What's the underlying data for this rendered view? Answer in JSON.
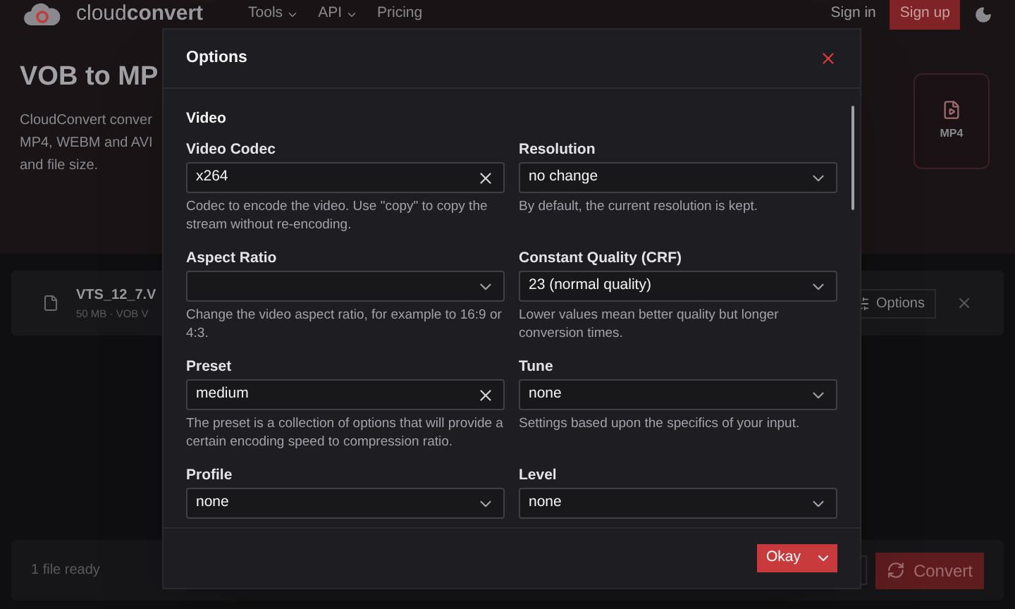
{
  "header": {
    "logo_text": "cloud**convert**",
    "nav": [
      {
        "label": "Tools",
        "dropdown": true
      },
      {
        "label": "API",
        "dropdown": true
      },
      {
        "label": "Pricing",
        "dropdown": false
      }
    ],
    "sign_in": "Sign in",
    "sign_up": "Sign up"
  },
  "hero": {
    "title": "VOB to MP",
    "description_lines": [
      "CloudConvert conver",
      "MP4, WEBM and AVI",
      "and file size."
    ],
    "target_format": "MP4"
  },
  "file": {
    "name": "VTS_12_7.V",
    "meta": "50 MB · VOB V",
    "options_button": "Options"
  },
  "footer": {
    "status": "1 file ready",
    "convert_button": "Convert"
  },
  "dialog": {
    "title": "Options",
    "section": "Video",
    "fields": [
      {
        "label": "Video Codec",
        "value": "x264",
        "kind": "clear",
        "hint": "Codec to encode the video. Use \"copy\" to copy the stream without re-encoding."
      },
      {
        "label": "Resolution",
        "value": "no change",
        "kind": "select",
        "hint": "By default, the current resolution is kept."
      },
      {
        "label": "Aspect Ratio",
        "kind": "select",
        "hint": "Change the video aspect ratio, for example to 16:9 or 4:3."
      },
      {
        "label": "Constant Quality (CRF)",
        "value": "23 (normal quality)",
        "kind": "select",
        "hint": "Lower values mean better quality but longer conversion times."
      },
      {
        "label": "Preset",
        "value": "medium",
        "kind": "clear",
        "hint": "The preset is a collection of options that will provide a certain encoding speed to compression ratio."
      },
      {
        "label": "Tune",
        "value": "none",
        "kind": "select",
        "hint": "Settings based upon the specifics of your input."
      },
      {
        "label": "Profile",
        "value": "none",
        "kind": "select"
      },
      {
        "label": "Level",
        "value": "none",
        "kind": "select"
      }
    ],
    "okay_button": "Okay"
  }
}
